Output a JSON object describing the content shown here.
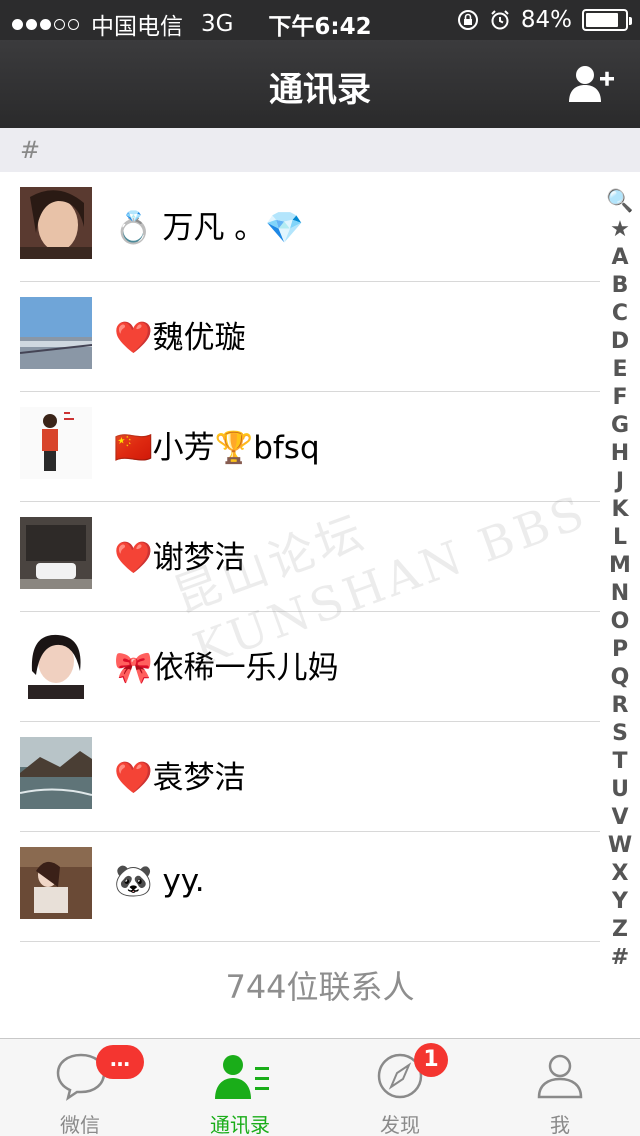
{
  "status_bar": {
    "carrier": "中国电信",
    "network": "3G",
    "time": "下午6:42",
    "battery": "84%",
    "battery_level": 0.84
  },
  "nav": {
    "title": "通讯录",
    "add_icon": "add-contact-icon"
  },
  "section_header": "#",
  "contacts": [
    {
      "name": "💍 万凡 。💎"
    },
    {
      "name": "❤️魏优璇"
    },
    {
      "name": "🇨🇳小芳🏆bfsq"
    },
    {
      "name": "❤️谢梦洁"
    },
    {
      "name": "🎀依稀一乐儿妈"
    },
    {
      "name": "❤️袁梦洁"
    },
    {
      "name": "            🐼  yy."
    }
  ],
  "index_bar": [
    "🔍",
    "★",
    "A",
    "B",
    "C",
    "D",
    "E",
    "F",
    "G",
    "H",
    "J",
    "K",
    "L",
    "M",
    "N",
    "O",
    "P",
    "Q",
    "R",
    "S",
    "T",
    "U",
    "V",
    "W",
    "X",
    "Y",
    "Z",
    "#"
  ],
  "contact_count": "744位联系人",
  "tabs": [
    {
      "label": "微信",
      "icon": "chat-bubble-icon",
      "badge": "…"
    },
    {
      "label": "通讯录",
      "icon": "contacts-icon",
      "active": true
    },
    {
      "label": "发现",
      "icon": "compass-icon",
      "badge": "1"
    },
    {
      "label": "我",
      "icon": "profile-icon"
    }
  ],
  "watermark": "昆山论坛 KUNSHAN BBS",
  "colors": {
    "accent_green": "#1aad19",
    "badge_red": "#f43530",
    "nav_bg": "#2f2f30"
  }
}
